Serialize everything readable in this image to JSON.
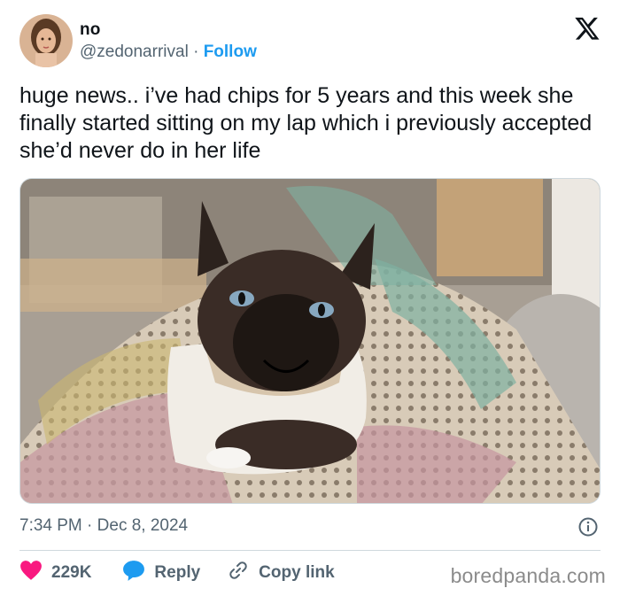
{
  "user": {
    "name": "no",
    "handle": "@zedonarrival",
    "separator": " · ",
    "follow_label": "Follow"
  },
  "tweet": {
    "text": "huge news.. i’ve had chips for 5 years and this week she finally started sitting on my lap which i previously accepted she’d never do in her life",
    "time": "7:34 PM",
    "dot": " · ",
    "date": "Dec 8, 2024"
  },
  "icons": {
    "brand": "x-logo-icon",
    "info": "info-icon",
    "like": "heart-icon",
    "reply": "reply-bubble-icon",
    "copy": "link-icon"
  },
  "actions": {
    "likes": "229K",
    "reply_label": "Reply",
    "copy_label": "Copy link"
  },
  "watermark": "boredpanda.com",
  "colors": {
    "accent": "#1d9bf0",
    "heart": "#f91880",
    "text": "#0f1419",
    "muted": "#536471"
  }
}
